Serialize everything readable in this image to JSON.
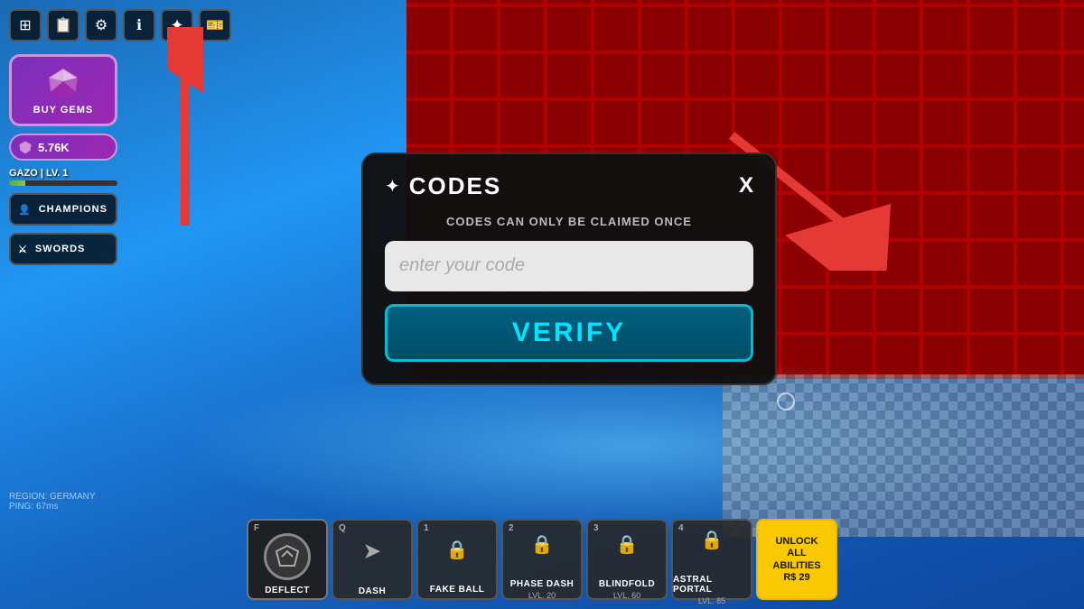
{
  "toolbar": {
    "buttons": [
      {
        "id": "inventory",
        "icon": "⊞"
      },
      {
        "id": "journal",
        "icon": "📖"
      },
      {
        "id": "settings",
        "icon": "⚙"
      },
      {
        "id": "info",
        "icon": "ℹ"
      },
      {
        "id": "sparkle",
        "icon": "✦"
      },
      {
        "id": "gamepass",
        "icon": "🎫"
      }
    ]
  },
  "sidebar": {
    "buy_gems_label": "BUY GEMS",
    "currency": "5.76K",
    "player_name": "GAZO | LV. 1",
    "champions_label": "CHAMPIONS",
    "swords_label": "SWORDS"
  },
  "modal": {
    "title": "CODES",
    "subtitle": "CODES CAN ONLY BE CLAIMED ONCE",
    "input_placeholder": "enter your code",
    "verify_label": "VERIFY",
    "close_label": "X"
  },
  "bottom_bar": {
    "abilities": [
      {
        "key": "F",
        "name": "DEFLECT",
        "level": "",
        "locked": false,
        "active": true
      },
      {
        "key": "Q",
        "name": "DASH",
        "level": "",
        "locked": false,
        "active": false
      },
      {
        "key": "1",
        "name": "FAKE BALL",
        "level": "",
        "locked": true,
        "active": false
      },
      {
        "key": "2",
        "name": "PHASE DASH",
        "level": "LVL. 20",
        "locked": true,
        "active": false
      },
      {
        "key": "3",
        "name": "BLINDFOLD",
        "level": "LVL. 60",
        "locked": true,
        "active": false
      },
      {
        "key": "4",
        "name": "ASTRAL PORTAL",
        "level": "LVL. 85",
        "locked": true,
        "active": false
      }
    ],
    "unlock_label": "UNLOCK\nALL\nABILITIES",
    "unlock_price": "R$ 29"
  },
  "region": {
    "text": "REGION: GERMANY",
    "ping": "PING: 67ms"
  },
  "colors": {
    "accent_teal": "#00e5ff",
    "accent_yellow": "#f9c800",
    "accent_purple": "#9c27b0",
    "arrow_red": "#e53935"
  }
}
